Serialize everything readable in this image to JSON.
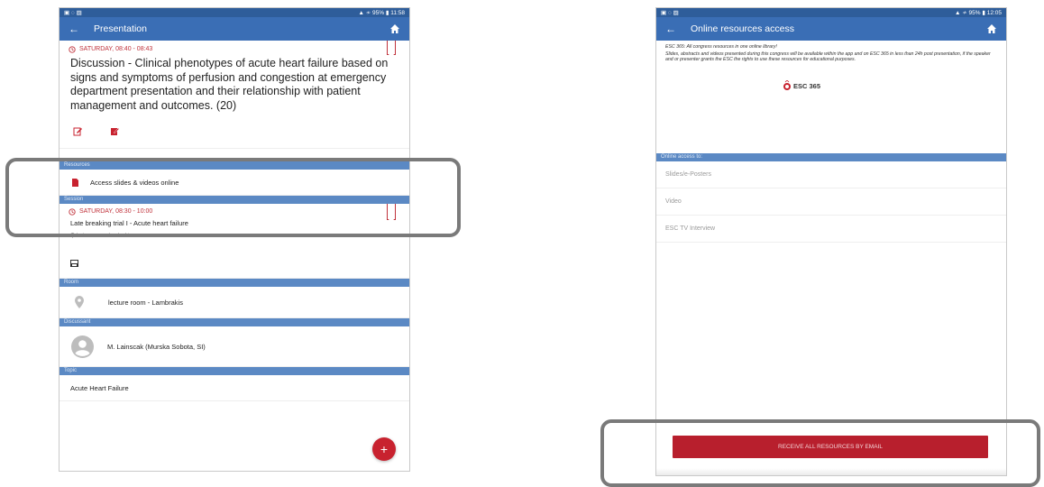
{
  "left": {
    "status": {
      "icons": "▣ ◌ ▨",
      "right": "▲ ≁ 95% ▮ 11:58"
    },
    "appbar": {
      "title": "Presentation"
    },
    "presentation": {
      "time": "SATURDAY, 08:40 - 08:43",
      "title": "Discussion - Clinical phenotypes of acute heart failure based on signs and symptoms of perfusion and congestion at emergency department presentation and their relationship with patient management and outcomes. (20)"
    },
    "resources": {
      "header": "Resources",
      "item": "Access slides & videos online"
    },
    "session": {
      "header": "Session",
      "time": "SATURDAY, 08:30 - 10:00",
      "title": "Late breaking trial I - Acute heart failure",
      "location": "lecture room - Lambrakis"
    },
    "room": {
      "header": "Room",
      "name": "lecture room - Lambrakis"
    },
    "discussant": {
      "header": "Discussant",
      "name": "M. Lainscak (Murska Sobota, SI)"
    },
    "topic": {
      "header": "Topic",
      "name": "Acute Heart Failure"
    },
    "fab": "+"
  },
  "right": {
    "status": {
      "icons": "▣ ◌ ▨",
      "right": "▲ ≁ 95% ▮ 12:05"
    },
    "appbar": {
      "title": "Online resources access"
    },
    "intro": {
      "line1": "ESC 365: All congress resources in one online library!",
      "line2": "Slides, abstracts and videos presented during this congress will be available within the app and on ESC 365 in less than 24h post presentation, if the speaker and or presenter grants the ESC the rights to use these resources for educational purposes."
    },
    "logo": {
      "text": "ESC 365"
    },
    "access": {
      "header": "Online access to:",
      "items": [
        "Slides/e-Posters",
        "Video",
        "ESC TV Interview"
      ]
    },
    "email_button": "RECEIVE ALL RESOURCES BY EMAIL"
  },
  "colors": {
    "appbar": "#3a6eb5",
    "statusbar": "#2e5d9a",
    "section": "#5b89c4",
    "accent_red": "#c0323b",
    "button_red": "#b81f2d",
    "highlight": "#7a7a7a"
  }
}
